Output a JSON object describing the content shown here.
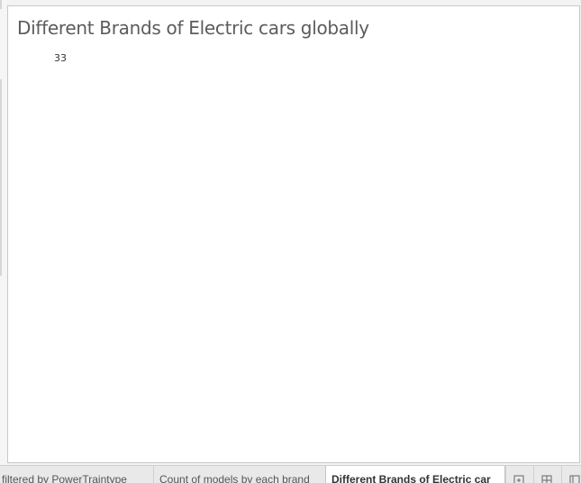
{
  "sheet": {
    "title": "Different Brands of Electric cars globally",
    "kpi_value": "33"
  },
  "tabs": [
    {
      "label": "d filtered by PowerTraintype",
      "active": false
    },
    {
      "label": "Count of models by each brand",
      "active": false
    },
    {
      "label": "Different Brands of Electric car",
      "active": true
    }
  ],
  "tab_buttons": [
    {
      "icon": "new-worksheet-icon"
    },
    {
      "icon": "new-dashboard-icon"
    },
    {
      "icon": "new-story-icon"
    }
  ],
  "colors": {
    "background": "#f3f3f3",
    "panel": "#ffffff",
    "title_text": "#5c5c5c",
    "tab_bar": "#e9e9e9",
    "active_tab": "#ffffff"
  }
}
